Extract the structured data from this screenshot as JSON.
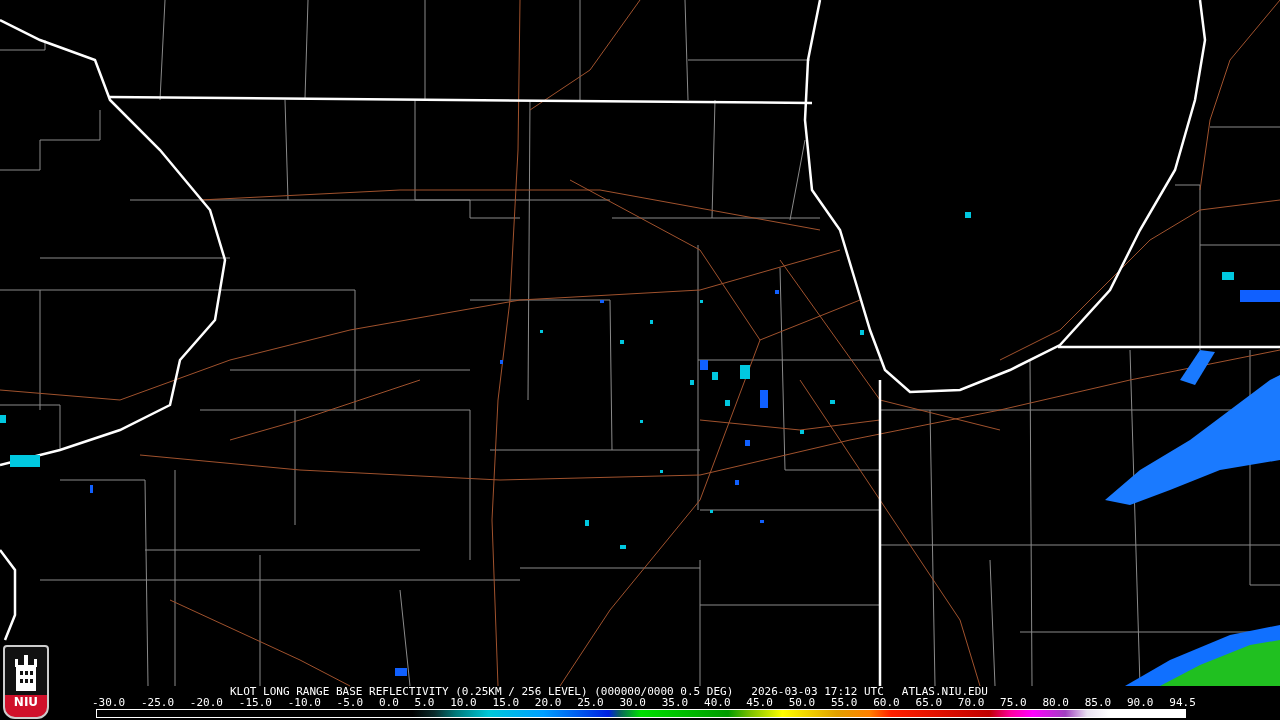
{
  "logo": {
    "text": "NIU"
  },
  "caption": {
    "product": "KLOT LONG RANGE BASE REFLECTIVITY (0.25KM / 256 LEVEL) (000000/0000 0.5 DEG)",
    "timestamp": "2026-03-03 17:12 UTC",
    "source": "ATLAS.NIU.EDU"
  },
  "scale": {
    "ticks": [
      "-30.0",
      "-25.0",
      "-20.0",
      "-15.0",
      "-10.0",
      "-5.0",
      "0.0",
      "5.0",
      "10.0",
      "15.0",
      "20.0",
      "25.0",
      "30.0",
      "35.0",
      "40.0",
      "45.0",
      "50.0",
      "55.0",
      "60.0",
      "65.0",
      "70.0",
      "75.0",
      "80.0",
      "85.0",
      "90.0",
      "94.5"
    ]
  }
}
